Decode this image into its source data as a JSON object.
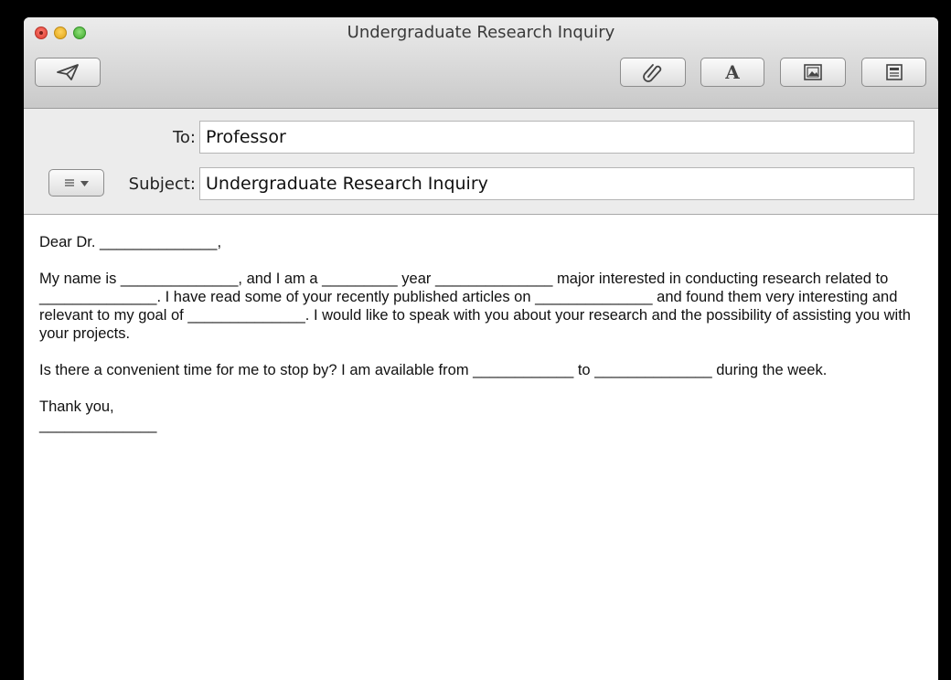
{
  "window": {
    "title": "Undergraduate Research Inquiry"
  },
  "toolbar": {
    "send_icon": "paper-plane-icon",
    "attach_icon": "paperclip-icon",
    "fonts_label": "A",
    "photo_icon": "photo-browser-icon",
    "template_icon": "stationery-icon"
  },
  "header": {
    "to_label": "To:",
    "to_value": "Professor",
    "subject_label": "Subject:",
    "subject_value": "Undergraduate Research Inquiry"
  },
  "message": {
    "greeting": "Dear Dr. ______________,",
    "paragraph1": "My name is ______________, and I am a _________ year ______________ major interested in conducting research related to ______________. I have read some of your recently published articles on ______________ and found them very interesting and relevant to my goal of ______________. I would like to speak with you about your research and the possibility of assisting you with your projects.",
    "paragraph2": "Is there a convenient time for me to stop by? I am available from ____________ to ______________ during the week.",
    "closing": "Thank you,",
    "signature": "______________"
  }
}
